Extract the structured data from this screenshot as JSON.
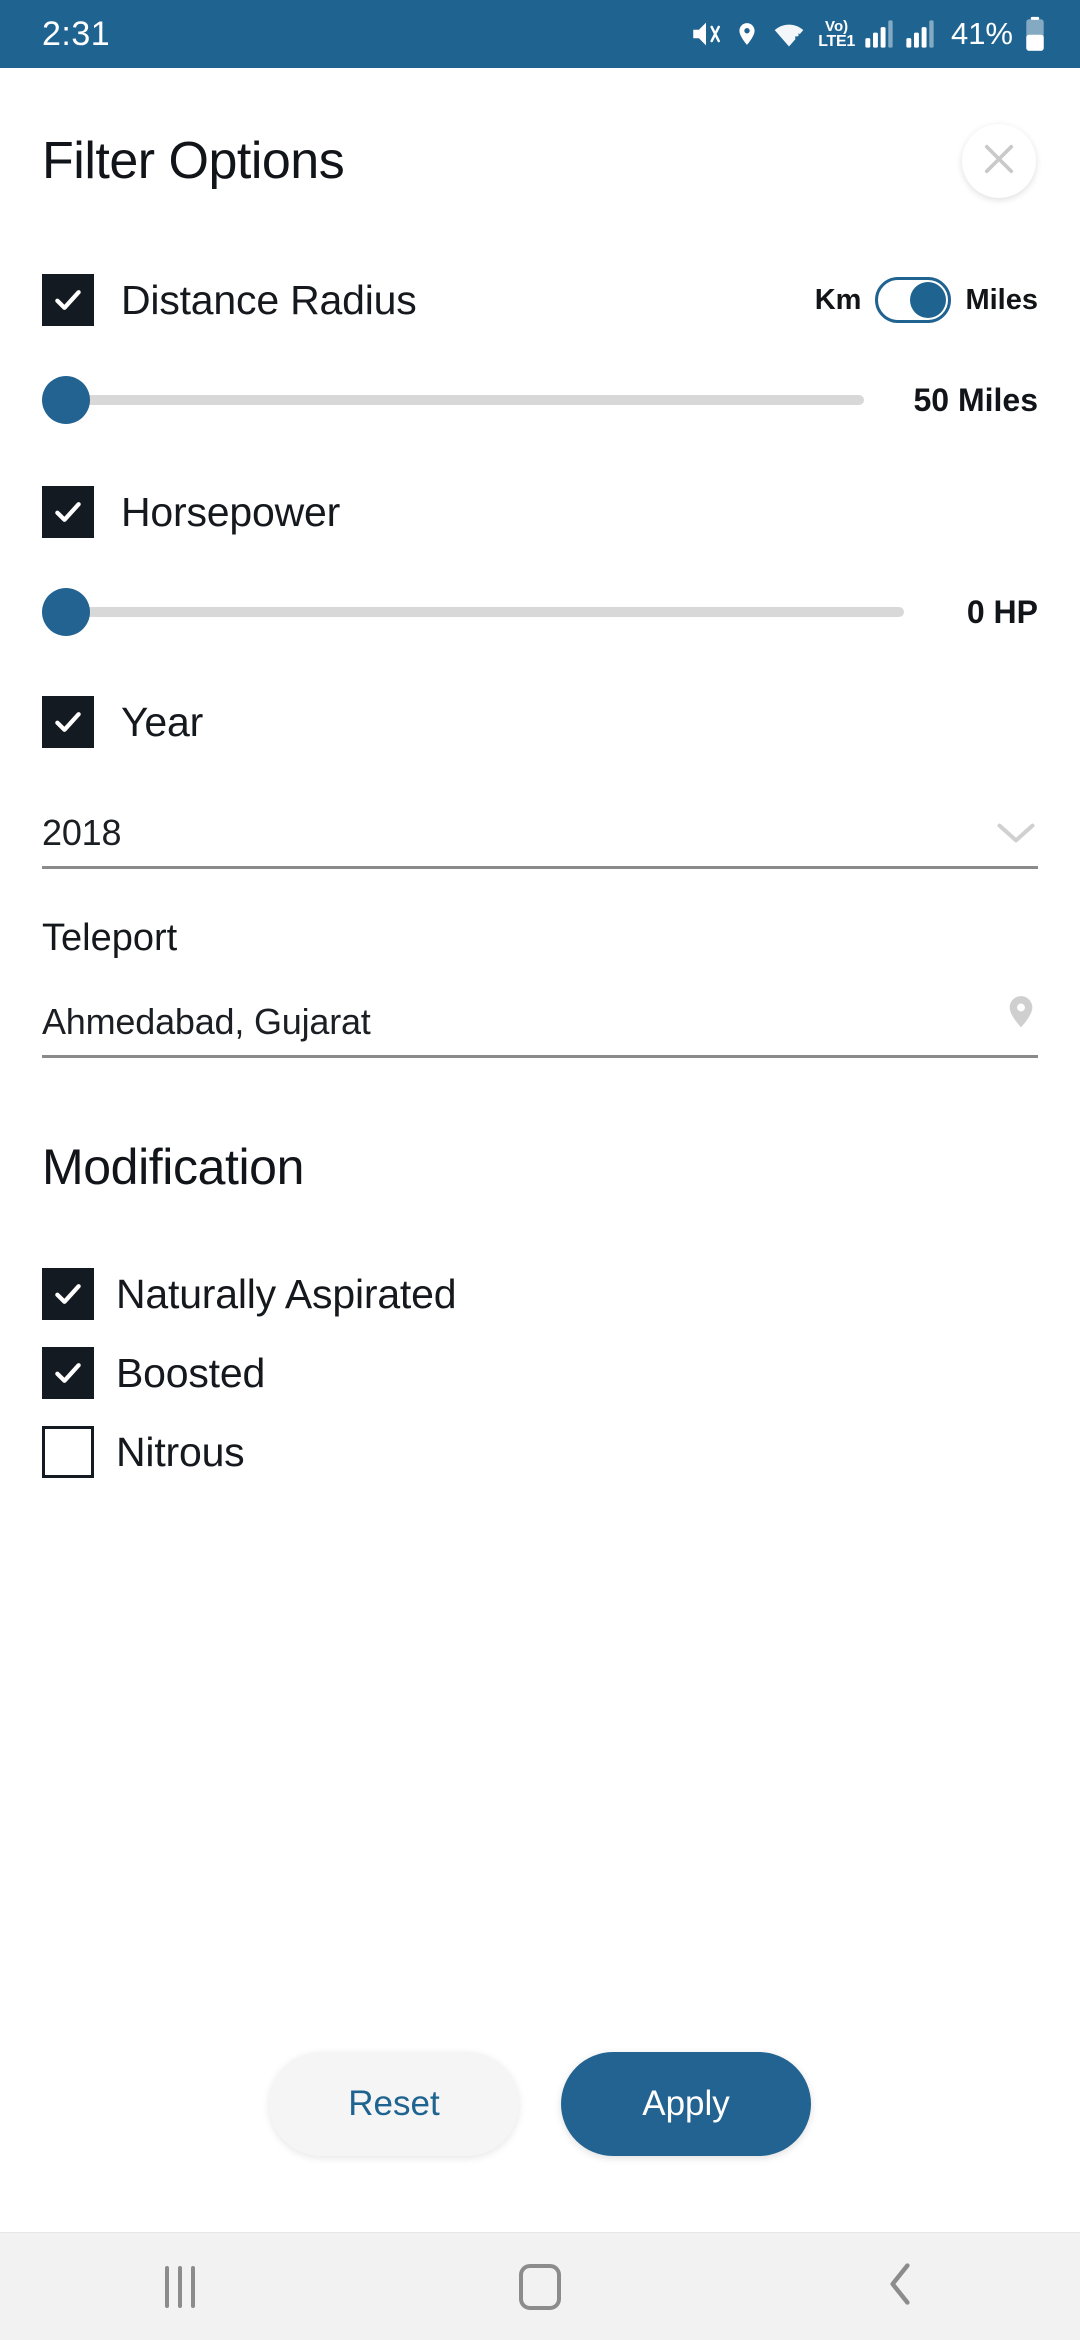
{
  "status_bar": {
    "time": "2:31",
    "battery_percent": "41%",
    "network_label_top": "Vo)",
    "network_label_bottom": "LTE1",
    "icons": [
      "mute-icon",
      "location-icon",
      "wifi-icon",
      "volte-icon",
      "signal-sim1-icon",
      "signal-sim2-icon",
      "battery-icon"
    ],
    "background_color": "#1F6391"
  },
  "header": {
    "title": "Filter Options",
    "close_icon": "close-icon"
  },
  "distance": {
    "checkbox_label": "Distance Radius",
    "checked": true,
    "unit_left": "Km",
    "unit_right": "Miles",
    "toggle_on_right": true,
    "slider_value_label": "50 Miles",
    "slider_percent": 0
  },
  "horsepower": {
    "checkbox_label": "Horsepower",
    "checked": true,
    "slider_value_label": "0 HP",
    "slider_percent": 0
  },
  "year": {
    "checkbox_label": "Year",
    "checked": true,
    "selected_value": "2018",
    "dropdown_icon": "chevron-down-icon"
  },
  "teleport": {
    "label": "Teleport",
    "value": "Ahmedabad, Gujarat",
    "icon": "map-pin-icon"
  },
  "modification": {
    "heading": "Modification",
    "options": [
      {
        "label": "Naturally Aspirated",
        "checked": true
      },
      {
        "label": "Boosted",
        "checked": true
      },
      {
        "label": "Nitrous",
        "checked": false
      }
    ]
  },
  "actions": {
    "reset_label": "Reset",
    "apply_label": "Apply",
    "accent_color": "#236392"
  },
  "navbar": {
    "recent_icon": "recent-apps-icon",
    "home_icon": "home-icon",
    "back_icon": "back-icon"
  }
}
